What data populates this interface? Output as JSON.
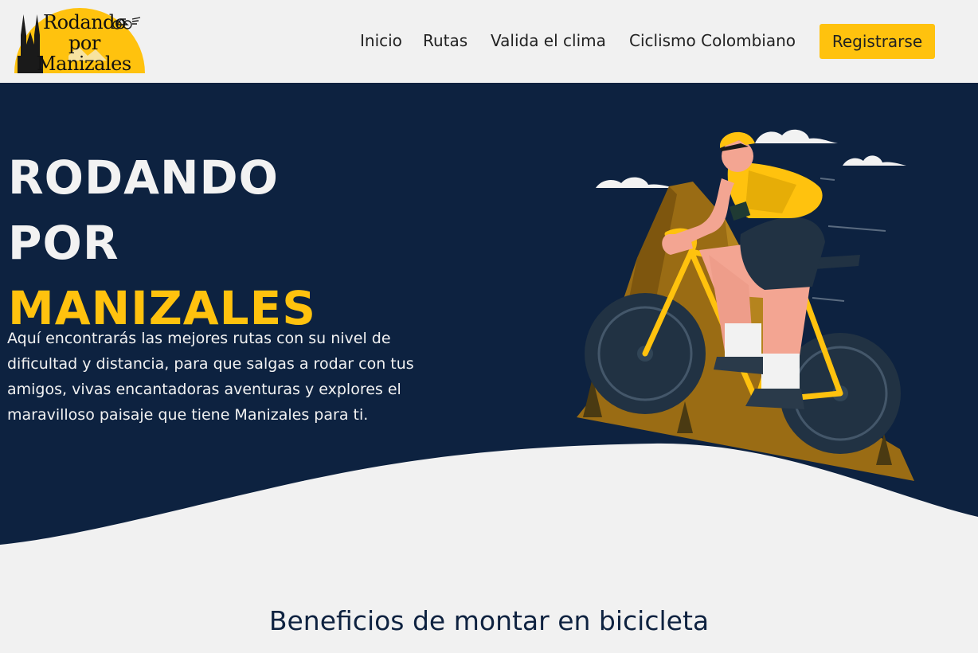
{
  "colors": {
    "navy": "#0d2240",
    "accent": "#ffc20e",
    "page_bg": "#f1f1f1",
    "text_light": "#f2f2f2"
  },
  "logo": {
    "line1": "Rodando",
    "line2": "por",
    "line3": "Manizales"
  },
  "nav": {
    "items": [
      {
        "label": "Inicio"
      },
      {
        "label": "Rutas"
      },
      {
        "label": "Valida el clima"
      },
      {
        "label": "Ciclismo Colombiano"
      }
    ],
    "cta": "Registrarse"
  },
  "hero": {
    "title_line1": "RODANDO",
    "title_line2": "POR",
    "title_line3": "MANIZALES",
    "description": "Aquí encontrarás las mejores rutas con su nivel de dificultad y distancia, para que salgas a rodar con tus amigos, vivas encantadoras aventuras y explores el maravilloso paisaje que tiene Manizales para ti."
  },
  "section": {
    "title": "Beneficios de montar en bicicleta"
  }
}
